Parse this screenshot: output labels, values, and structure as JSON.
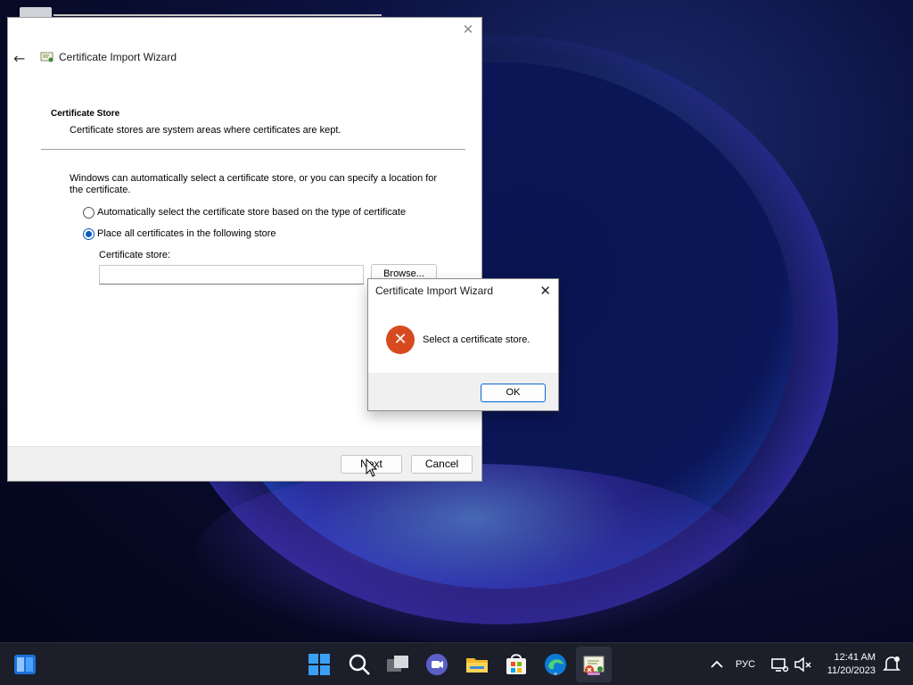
{
  "wizard": {
    "title": "Certificate Import Wizard",
    "section_title": "Certificate Store",
    "section_subtitle": "Certificate stores are system areas where certificates are kept.",
    "intro": "Windows can automatically select a certificate store, or you can specify a location for the certificate.",
    "radio_auto_label": "Automatically select the certificate store based on the type of certificate",
    "radio_manual_label": "Place all certificates in the following store",
    "selected_option": "manual",
    "store_label": "Certificate store:",
    "store_value": "",
    "browse_label": "Browse...",
    "next_label": "Next",
    "cancel_label": "Cancel"
  },
  "dialog": {
    "title": "Certificate Import Wizard",
    "message": "Select a certificate store.",
    "ok_label": "OK",
    "close_glyph": "✕",
    "icon": "error-icon"
  },
  "taskbar": {
    "language": "РУС",
    "time": "12:41 AM",
    "date": "11/20/2023",
    "icons": [
      "widgets-icon",
      "start-icon",
      "search-icon",
      "task-view-icon",
      "teams-chat-icon",
      "file-explorer-icon",
      "store-icon",
      "edge-icon",
      "cert-wizard-app-icon",
      "tray-chevron-icon",
      "network-icon",
      "volume-muted-icon",
      "notifications-icon"
    ]
  },
  "colors": {
    "accent": "#0a5bbd",
    "error": "#d74a1f",
    "taskbar": "#1c1f2a"
  }
}
